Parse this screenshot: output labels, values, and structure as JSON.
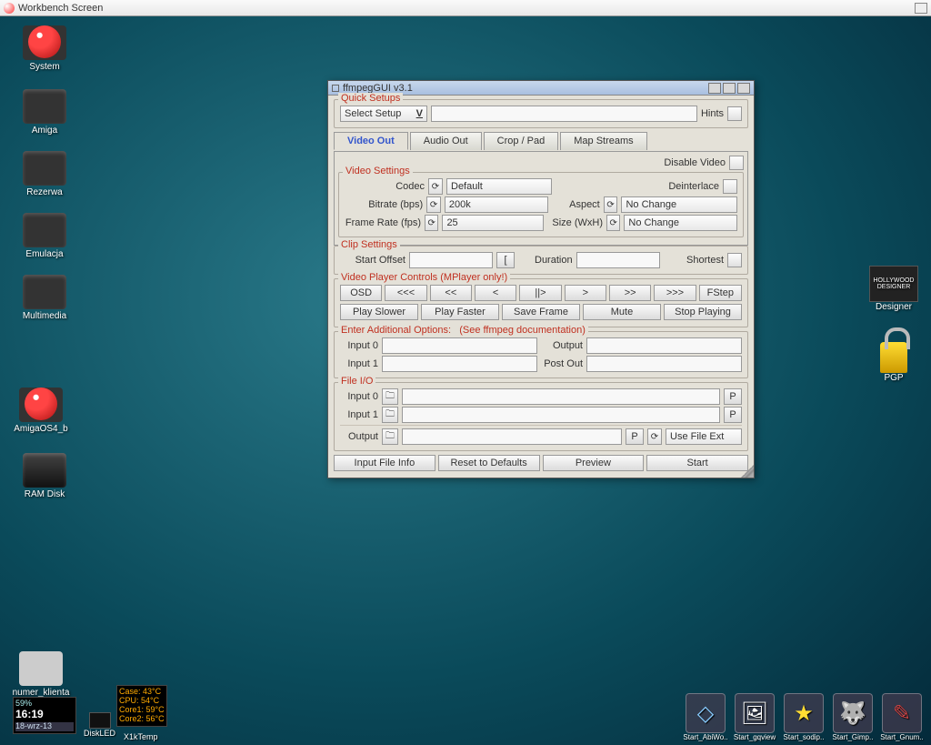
{
  "titlebar": {
    "text": "Workbench Screen"
  },
  "desktop_icons_left": [
    {
      "label": "System"
    },
    {
      "label": "Amiga"
    },
    {
      "label": "Rezerwa"
    },
    {
      "label": "Emulacja"
    },
    {
      "label": "Multimedia"
    },
    {
      "label": "AmigaOS4_b"
    },
    {
      "label": "RAM Disk"
    },
    {
      "label": "numer_klienta"
    }
  ],
  "desktop_icons_right": [
    {
      "label": "Designer"
    },
    {
      "label": "PGP"
    }
  ],
  "win_title": "ffmpegGUI  v3.1",
  "quick_setups": {
    "title": "Quick Setups",
    "select": "Select Setup",
    "hints": "Hints"
  },
  "tabs": [
    "Video Out",
    "Audio Out",
    "Crop / Pad",
    "Map Streams"
  ],
  "disable_video": "Disable Video",
  "video_settings": {
    "title": "Video Settings",
    "codec_lbl": "Codec",
    "codec": "Default",
    "bitrate_lbl": "Bitrate (bps)",
    "bitrate": "200k",
    "fps_lbl": "Frame Rate (fps)",
    "fps": "25",
    "deinterlace": "Deinterlace",
    "aspect_lbl": "Aspect",
    "aspect": "No Change",
    "size_lbl": "Size (WxH)",
    "size": "No Change"
  },
  "clip": {
    "title": "Clip Settings",
    "start": "Start Offset",
    "bracket": "[",
    "duration": "Duration",
    "shortest": "Shortest"
  },
  "player": {
    "title": "Video Player Controls (MPlayer only!)",
    "row1": [
      "OSD",
      "<<<",
      "<<",
      "<",
      "||>",
      ">",
      ">>",
      ">>>",
      "FStep"
    ],
    "row2": [
      "Play Slower",
      "Play Faster",
      "Save Frame",
      "Mute",
      "Stop Playing"
    ]
  },
  "extra": {
    "title": "Enter Additional Options:",
    "see": "(See ffmpeg documentation)",
    "in0": "Input 0",
    "in1": "Input 1",
    "out": "Output",
    "post": "Post Out"
  },
  "fileio": {
    "title": "File I/O",
    "in0": "Input 0",
    "in1": "Input 1",
    "out": "Output",
    "p": "P",
    "ext": "Use File Ext"
  },
  "bottom_btns": [
    "Input File Info",
    "Reset to Defaults",
    "Preview",
    "Start"
  ],
  "dock": [
    "Start_AbiWo..",
    "Start_gqview",
    "Start_sodip..",
    "Start_Gimp..",
    "Start_Gnum.."
  ],
  "widgets": {
    "clock1": "59%",
    "clock2": "16:19",
    "date": "18-wrz-13",
    "diskled": "DiskLED",
    "temps": {
      "case": "Case:  43°C",
      "cpu": "CPU:   54°C",
      "c1": "Core1: 59°C",
      "c2": "Core2: 56°C"
    },
    "x1k": "X1kTemp"
  }
}
